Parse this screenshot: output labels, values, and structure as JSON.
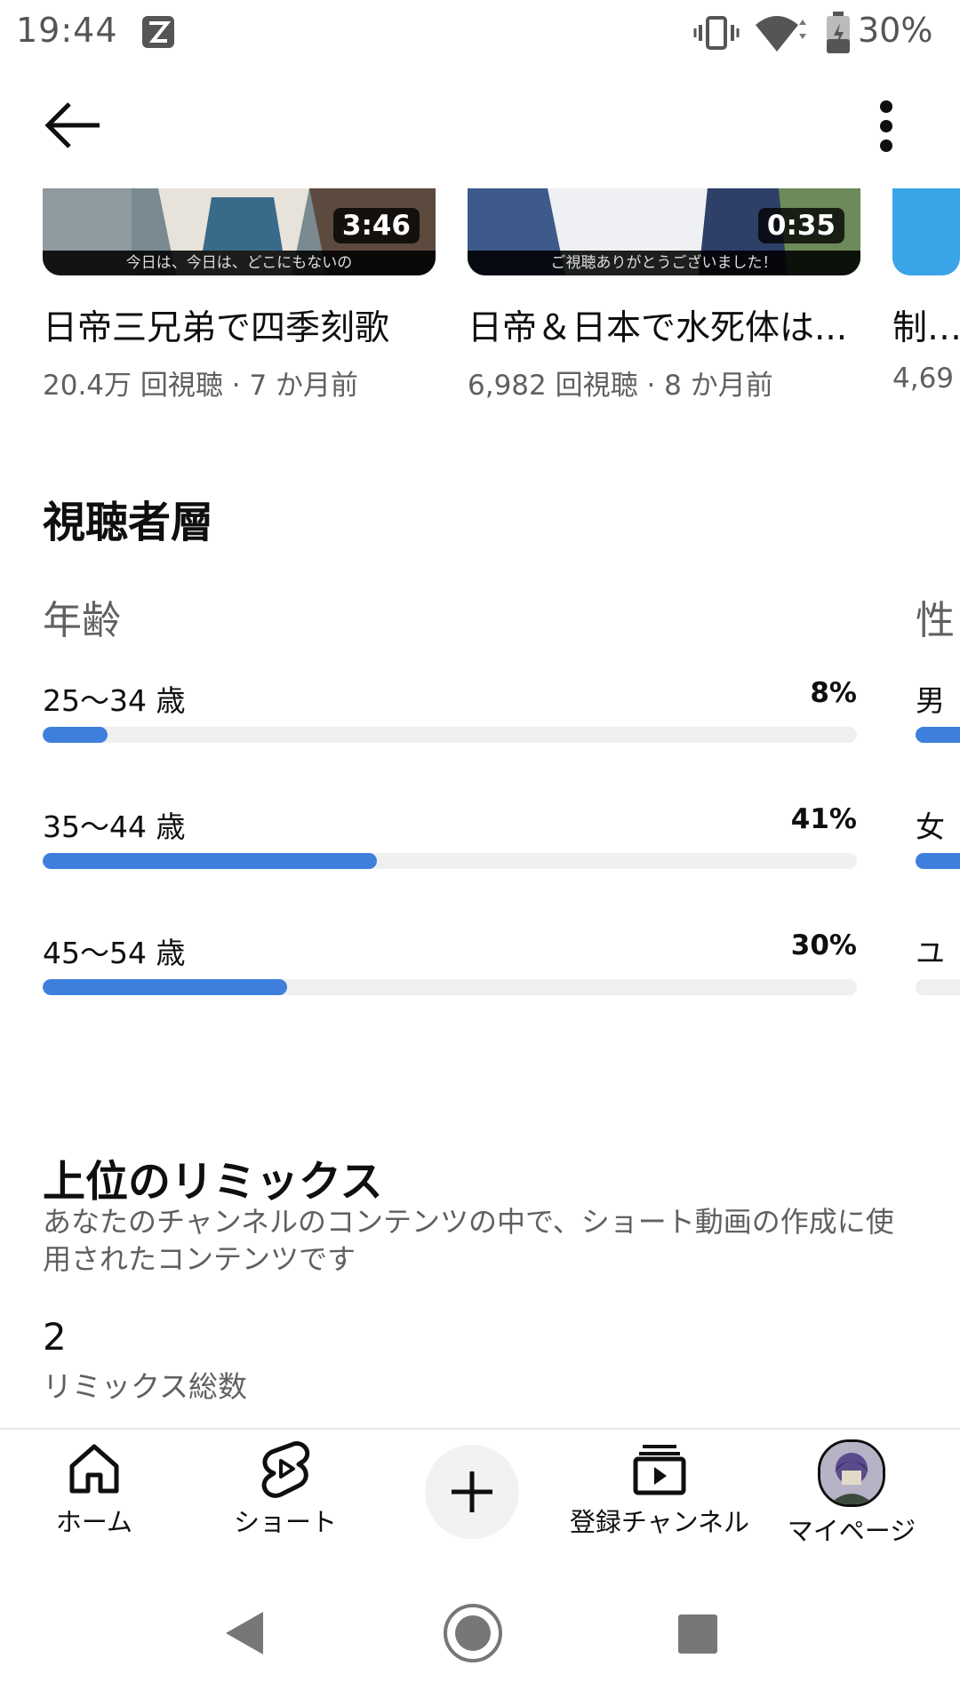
{
  "status_bar": {
    "time": "19:44",
    "battery": "30%",
    "icons": [
      "app-notification-icon",
      "vibrate-icon",
      "wifi-icon",
      "battery-icon"
    ]
  },
  "top_bar": {
    "icons": [
      "back-arrow-icon",
      "more-vert-icon"
    ]
  },
  "videos": [
    {
      "title": "日帝三兄弟で四季刻歌",
      "meta": "20.4万 回視聴 · 7 か月前",
      "duration": "3:46",
      "subtitle": "今日は、今日は、どこにもないの"
    },
    {
      "title": "日帝＆日本で水死体は...",
      "meta": "6,982 回視聴 · 8 か月前",
      "duration": "0:35",
      "subtitle": "ご視聴ありがとうございました！"
    },
    {
      "title": "制作",
      "meta": "4,69"
    }
  ],
  "audience": {
    "title": "視聴者層",
    "age_heading": "年齢",
    "age_groups": [
      {
        "label": "25〜34 歳",
        "value": "8%",
        "percent": 8
      },
      {
        "label": "35〜44 歳",
        "value": "41%",
        "percent": 41
      },
      {
        "label": "45〜54 歳",
        "value": "30%",
        "percent": 30
      }
    ],
    "gender_heading": "性",
    "gender_labels": [
      "男",
      "女",
      "ユ"
    ]
  },
  "remix": {
    "title": "上位のリミックス",
    "description": "あなたのチャンネルのコンテンツの中で、ショート動画の作成に使用されたコンテンツです",
    "count": "2",
    "count_label": "リミックス総数"
  },
  "bottom_nav": {
    "items": [
      {
        "label": "ホーム",
        "icon": "home-icon"
      },
      {
        "label": "ショート",
        "icon": "shorts-icon"
      },
      {
        "label": "",
        "icon": "create-plus-icon"
      },
      {
        "label": "登録チャンネル",
        "icon": "subscriptions-icon"
      },
      {
        "label": "マイページ",
        "icon": "avatar"
      }
    ]
  },
  "colors": {
    "accent": "#3e7fdd",
    "track": "#efefef",
    "secondary_text": "#606060"
  }
}
